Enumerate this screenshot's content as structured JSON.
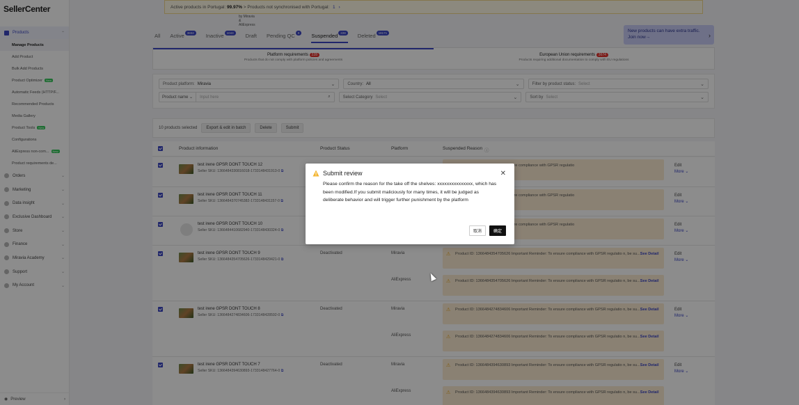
{
  "app": {
    "name": "SellerCenter",
    "subtitle": "by Miravia & AliExpress"
  },
  "sidebar": {
    "products_label": "Products",
    "sub_items": [
      {
        "label": "Manage Products",
        "active": true
      },
      {
        "label": "Add Product"
      },
      {
        "label": "Bulk Add Products"
      },
      {
        "label": "Product Optimizer",
        "badge": "New"
      },
      {
        "label": "Automatic Feeds (HTTP/F..."
      },
      {
        "label": "Recommended Products"
      },
      {
        "label": "Media Gallery"
      },
      {
        "label": "Product Tools",
        "badge": "New"
      },
      {
        "label": "Configurations"
      },
      {
        "label": "AliExpress non-com...",
        "badge": "New"
      },
      {
        "label": "Product requirements de..."
      }
    ],
    "sections": [
      {
        "label": "Orders"
      },
      {
        "label": "Marketing"
      },
      {
        "label": "Data insight"
      },
      {
        "label": "Exclusive Dashboard"
      },
      {
        "label": "Store"
      },
      {
        "label": "Finance"
      },
      {
        "label": "Miravia Academy"
      },
      {
        "label": "Support"
      },
      {
        "label": "My Account"
      }
    ],
    "footer": "Preview"
  },
  "banner": {
    "text1": "Active products in Portugal:",
    "pct": "99.97%",
    "text2": "Products not synchronised with Portugal:",
    "count": "1"
  },
  "tabs": [
    {
      "label": "All"
    },
    {
      "label": "Active",
      "count": "3832"
    },
    {
      "label": "Inactive",
      "count": "1043"
    },
    {
      "label": "Draft"
    },
    {
      "label": "Pending QC",
      "count": "0"
    },
    {
      "label": "Suspended",
      "count": "228",
      "active": true
    },
    {
      "label": "Deleted",
      "count": "18171"
    }
  ],
  "promo": {
    "line1": "New products can have extra traffic.",
    "line2": "Join now→"
  },
  "requirements": [
    {
      "title": "Platform requirements",
      "count": "228",
      "desc": "Products that do not comply with platform policies and agreements",
      "active": true
    },
    {
      "title": "European Union requirements",
      "count": "3674",
      "desc": "Products requiring additional documentation to comply with EU regulations"
    }
  ],
  "filters": {
    "platform_label": "Product platform:",
    "platform_value": "Miravia",
    "country_label": "Country:",
    "country_value": "All",
    "status_label": "Filter by product status:",
    "status_placeholder": "Select",
    "name_label": "Product name",
    "name_placeholder": "Input here",
    "category_label": "Select Category",
    "category_placeholder": "Select",
    "sort_label": "Sort by",
    "sort_placeholder": "Select"
  },
  "toolbar": {
    "selected": "10 products selected",
    "export": "Export & edit in batch",
    "delete": "Delete",
    "submit": "Submit"
  },
  "table": {
    "headers": {
      "info": "Product information",
      "status": "Product Status",
      "platform": "Platform",
      "reason": "Suspended Reason"
    },
    "rows": [
      {
        "name": "test irene GPSR DONT TOUCH 12",
        "sku": "Seller SKU: 1366484330816018-1733148431913-0",
        "status": "",
        "platforms": [],
        "reasons": [
          "...18 Important Reminder: To ensure compliance with GPSR regulatio"
        ]
      },
      {
        "name": "test irene GPSR DONT TOUCH 11",
        "sku": "Seller SKU: 1366484370745382-1733148431157-0",
        "status": "",
        "platforms": [],
        "reasons": [
          "...82 Important Reminder: To ensure compliance with GPSR regulatio"
        ]
      },
      {
        "name": "test irene GPSR DONT TOUCH 10",
        "sku": "Seller SKU: 1366484410682940-1733148430324-0",
        "status": "",
        "platforms": [],
        "reasons": [
          "...40 Important Reminder: To ensure compliance with GPSR regulatio"
        ]
      },
      {
        "name": "test irene GPSR DONT TOUCH 9",
        "sku": "Seller SKU: 1366484354705626-1733148429421-0",
        "status": "Deactivated",
        "platforms": [
          "Miravia",
          "AliExpress"
        ],
        "reasons": [
          "Product ID: 1366484354705626 Important Reminder: To ensure compliance with GPSR regulatio n, be su...",
          "Product ID: 1366484354705626 Important Reminder: To ensure compliance with GPSR regulatio n, be su..."
        ]
      },
      {
        "name": "test irene GPSR DONT TOUCH 8",
        "sku": "Seller SKU: 1366484274834606-1733148428592-0",
        "status": "Deactivated",
        "platforms": [
          "Miravia",
          "AliExpress"
        ],
        "reasons": [
          "Product ID: 1366484274834606 Important Reminder: To ensure compliance with GPSR regulatio n, be su...",
          "Product ID: 1366484274834606 Important Reminder: To ensure compliance with GPSR regulatio n, be su..."
        ]
      },
      {
        "name": "test irene GPSR DONT TOUCH 7",
        "sku": "Seller SKU: 1366484394630893-1733148427764-0",
        "status": "Deactivated",
        "platforms": [
          "Miravia",
          "AliExpress"
        ],
        "reasons": [
          "Product ID: 1366484394630893 Important Reminder: To ensure compliance with GPSR regulatio n, be su...",
          "Product ID: 1366484394630893 Important Reminder: To ensure compliance with GPSR regulatio n, be su..."
        ]
      }
    ],
    "see_detail": "See Detail",
    "edit": "Edit",
    "more": "More"
  },
  "modal": {
    "title": "Submit review",
    "body": "Please confirm the reason for the take off the shelves: xxxxxxxxxxxxxxx, which has been modified.If you submit maliciously for many times, it will be judged as deliberate behavior and will trigger further punishment by the platform",
    "cancel": "取消",
    "confirm": "确定"
  },
  "colors": {
    "accent": "#3b45c4",
    "warning": "#e6a117",
    "reason_bg": "#fcecd2"
  }
}
